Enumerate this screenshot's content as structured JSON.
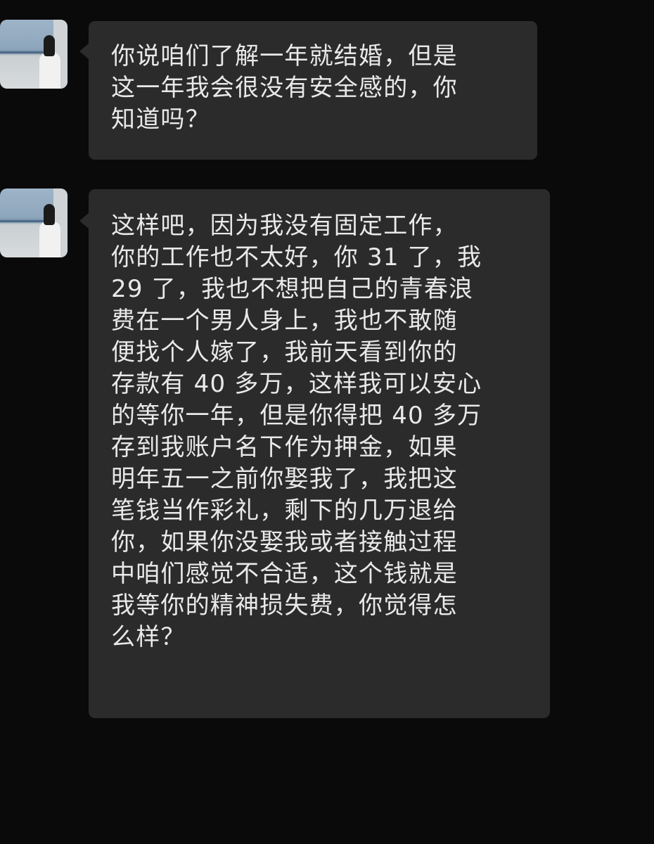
{
  "messages": [
    {
      "text": "你说咱们了解一年就结婚，但是\n这一年我会很没有安全感的，你\n知道吗？"
    },
    {
      "text": "这样吧，因为我没有固定工作，\n你的工作也不太好，你 31 了，我\n29 了，我也不想把自己的青春浪\n费在一个男人身上，我也不敢随\n便找个人嫁了，我前天看到你的\n存款有 40 多万，这样我可以安心\n的等你一年，但是你得把 40 多万\n存到我账户名下作为押金，如果\n明年五一之前你娶我了，我把这\n笔钱当作彩礼，剩下的几万退给\n你，如果你没娶我或者接触过程\n中咱们感觉不合适，这个钱就是\n我等你的精神损失费，你觉得怎\n么样？"
    }
  ],
  "colors": {
    "background": "#0a0a0a",
    "bubble": "#2b2b2b",
    "text": "#e9e9e9"
  }
}
